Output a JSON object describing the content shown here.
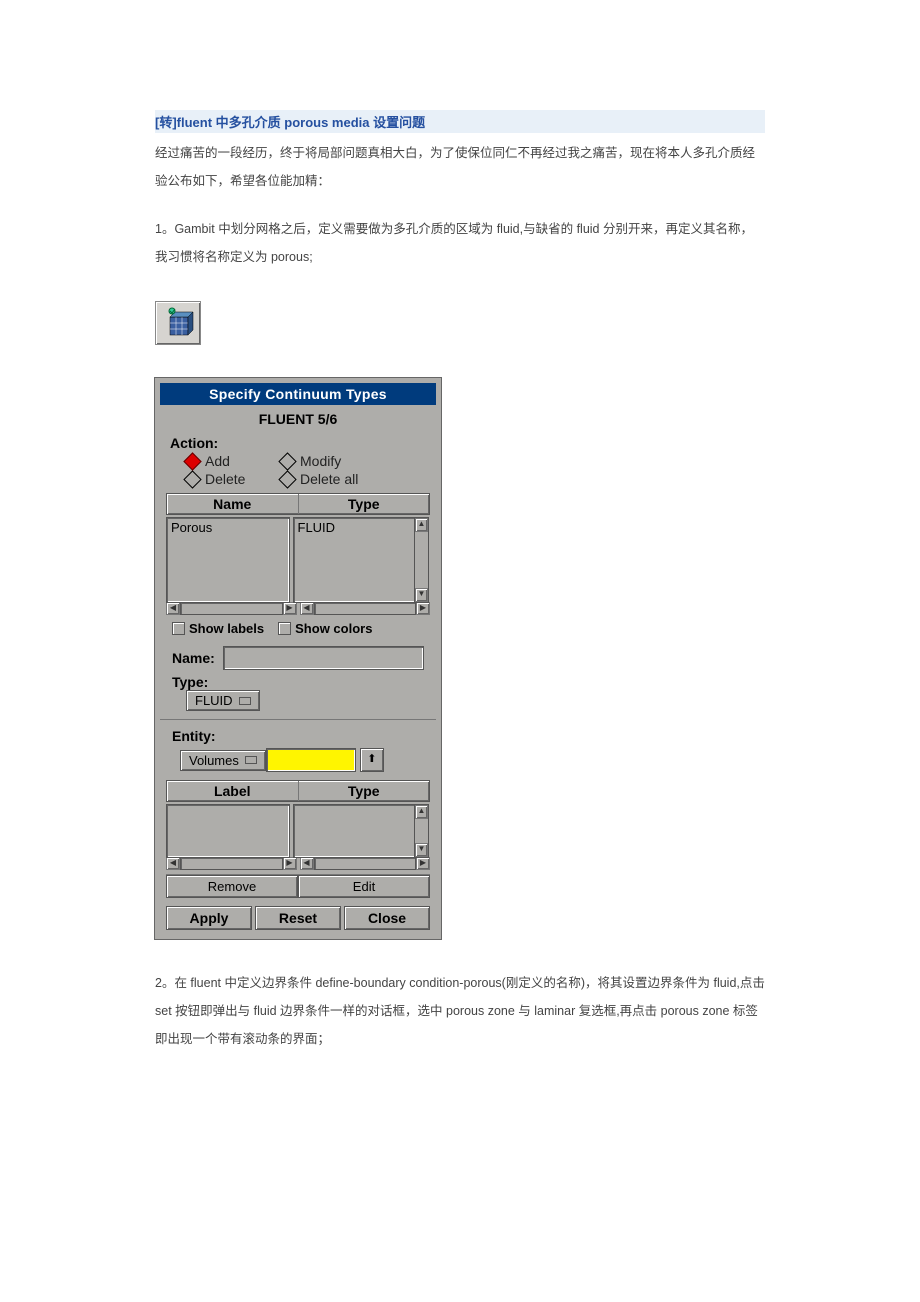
{
  "title": "[转]fluent 中多孔介质 porous media 设置问题",
  "paragraph_intro": "经过痛苦的一段经历，终于将局部问题真相大白，为了使保位同仁不再经过我之痛苦，现在将本人多孔介质经验公布如下，希望各位能加精：",
  "paragraph_1": "1。Gambit 中划分网格之后，定义需要做为多孔介质的区域为 fluid,与缺省的 fluid 分别开来，再定义其名称，我习惯将名称定义为 porous;",
  "paragraph_2": "2。在 fluent 中定义边界条件 define-boundary condition-porous(刚定义的名称)，将其设置边界条件为 fluid,点击 set 按钮即弹出与 fluid 边界条件一样的对话框，选中 porous zone 与 laminar 复选框,再点击 porous zone 标签即出现一个带有滚动条的界面；",
  "dialog": {
    "title": "Specify Continuum Types",
    "subtitle": "FLUENT 5/6",
    "action_label": "Action:",
    "radio_add": "Add",
    "radio_modify": "Modify",
    "radio_delete": "Delete",
    "radio_delete_all": "Delete all",
    "col_name": "Name",
    "col_type": "Type",
    "list_name_value": "Porous",
    "list_type_value": "FLUID",
    "show_labels": "Show labels",
    "show_colors": "Show colors",
    "name_label": "Name:",
    "type_label": "Type:",
    "type_value": "FLUID",
    "entity_label": "Entity:",
    "entity_select": "Volumes",
    "col_label": "Label",
    "col_type2": "Type",
    "remove": "Remove",
    "edit": "Edit",
    "apply": "Apply",
    "reset": "Reset",
    "close": "Close"
  }
}
